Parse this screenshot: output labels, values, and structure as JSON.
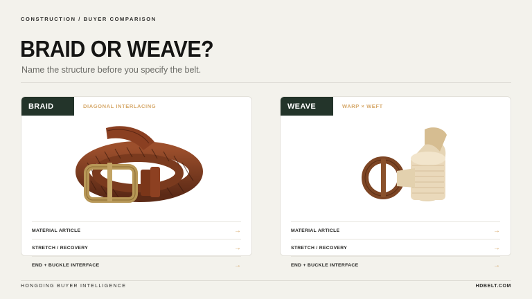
{
  "header": {
    "eyebrow": "CONSTRUCTION / BUYER COMPARISON",
    "title": "BRAID OR WEAVE?",
    "subtitle": "Name the structure before you specify the belt."
  },
  "cards": [
    {
      "tag": "BRAID",
      "descriptor": "DIAGONAL INTERLACING",
      "image": "braided-leather-belt-image",
      "rows": [
        {
          "label": "MATERIAL ARTICLE",
          "icon": "arrow-right-icon",
          "arrow": "→"
        },
        {
          "label": "STRETCH / RECOVERY",
          "icon": "arrow-right-icon",
          "arrow": "→"
        },
        {
          "label": "END + BUCKLE INTERFACE",
          "icon": "arrow-right-icon",
          "arrow": "→"
        }
      ]
    },
    {
      "tag": "WEAVE",
      "descriptor": "WARP × WEFT",
      "image": "woven-elastic-belt-image",
      "rows": [
        {
          "label": "MATERIAL ARTICLE",
          "icon": "arrow-right-icon",
          "arrow": "→"
        },
        {
          "label": "STRETCH / RECOVERY",
          "icon": "arrow-right-icon",
          "arrow": "→"
        },
        {
          "label": "END + BUCKLE INTERFACE",
          "icon": "arrow-right-icon",
          "arrow": "→"
        }
      ]
    }
  ],
  "footer": {
    "left": "HONGDING BUYER INTELLIGENCE",
    "right": "HDBELT.COM"
  },
  "colors": {
    "background": "#f3f2ec",
    "tag": "#23342a",
    "accent": "#d6a86a",
    "text": "#1d1d1b"
  }
}
